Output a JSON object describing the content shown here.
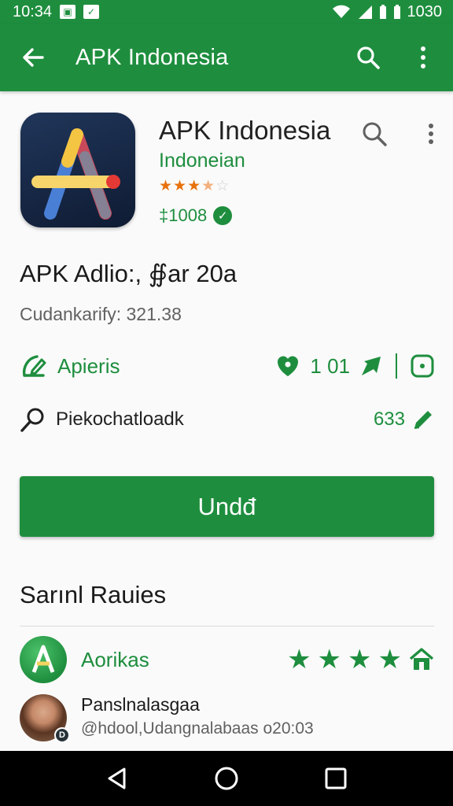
{
  "status_bar": {
    "time": "10:34",
    "battery_time": "1030"
  },
  "app_bar": {
    "title": "APK Indonesia",
    "back_icon": "arrow-back-icon",
    "search_icon": "search-icon",
    "more_icon": "more-vert-icon"
  },
  "app": {
    "name": "APK Indonesia",
    "developer": "Indoneian",
    "rating_stars": 3.5,
    "downloads": "‡1008",
    "subtitle": "APK Adlio:, ∯ar 20a",
    "meta": "Cudankarify: 321.38"
  },
  "row_a": {
    "label": "Apieris",
    "value": "1 01"
  },
  "row_b": {
    "label": "Piekochatloadk",
    "value": "633"
  },
  "install_button": "Undđ",
  "reviews": {
    "section_title": "Sarınl Rauies",
    "app_label": "Aorikas",
    "stars": 4,
    "reviewer_name": "Panslnalasgaa",
    "reviewer_meta": "@hdool,Udangnalabaas  o20:03",
    "avatar_badge": "D"
  },
  "colors": {
    "primary": "#1e8e3e",
    "star_orange": "#e8710a",
    "text": "#212121",
    "secondary_text": "#616161"
  }
}
